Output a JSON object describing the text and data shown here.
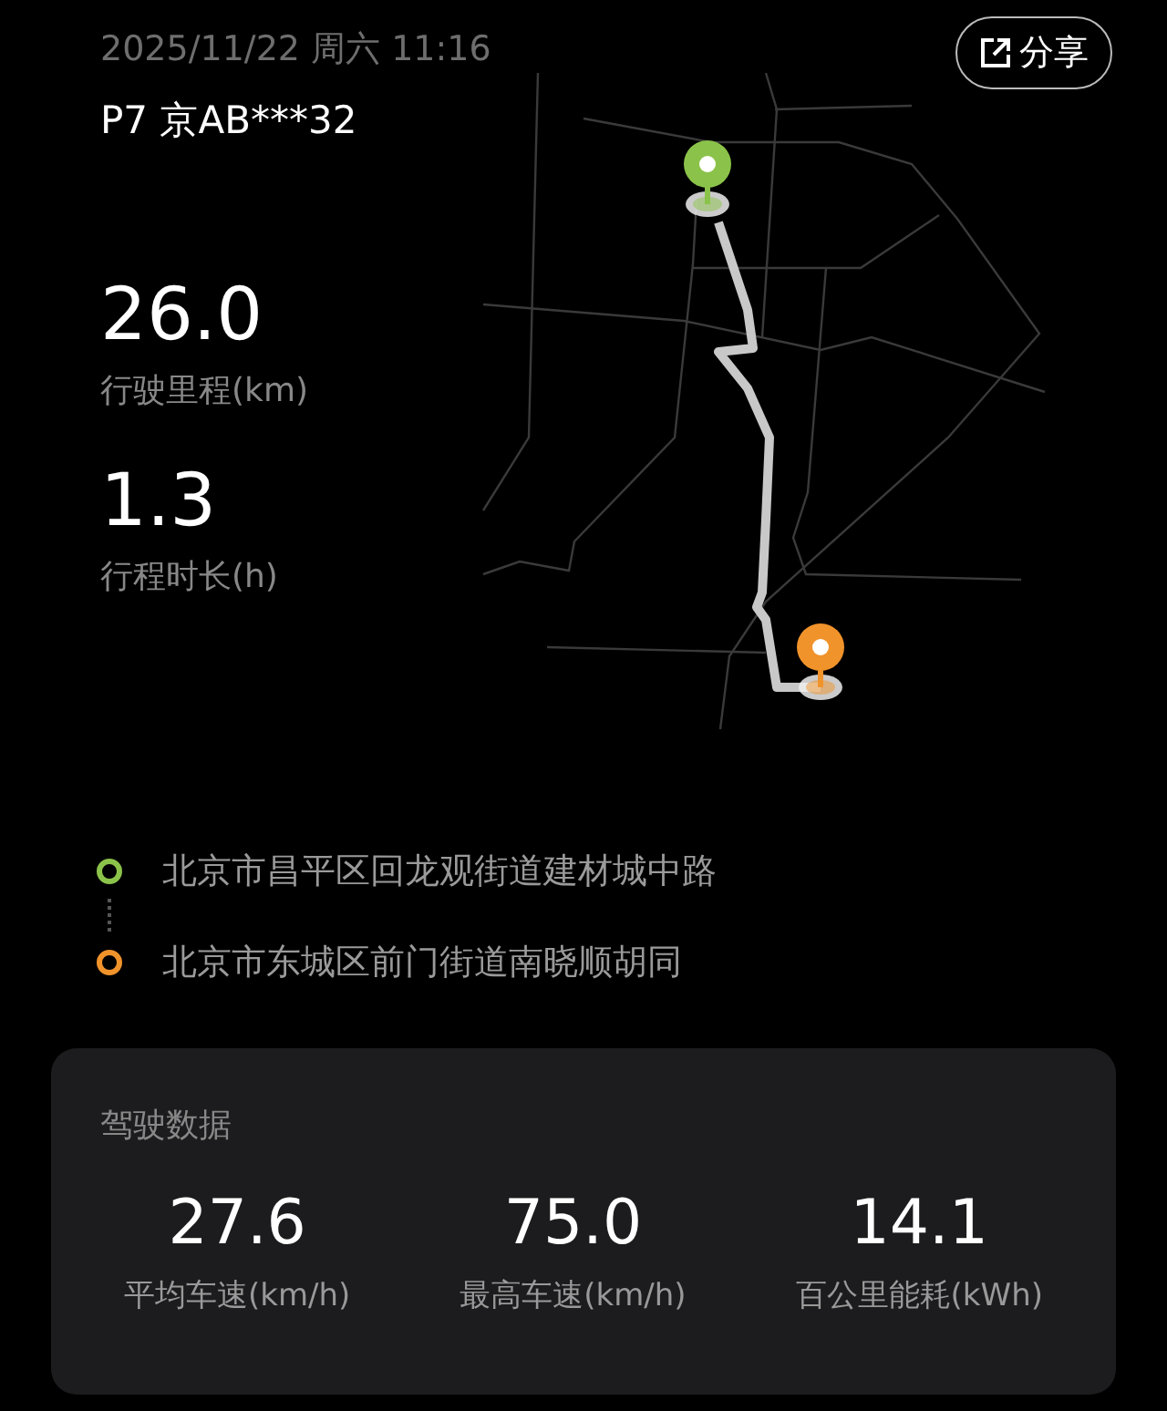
{
  "header": {
    "datetime": "2025/11/22 周六 11:16",
    "vehicle": "P7 京AB***32",
    "share": {
      "label": "分享"
    }
  },
  "stats": [
    {
      "value": "26.0",
      "label": "行驶里程(km)"
    },
    {
      "value": "1.3",
      "label": "行程时长(h)"
    }
  ],
  "addresses": [
    {
      "text": "北京市昌平区回龙观街道建材城中路",
      "color": "#8bc34a"
    },
    {
      "text": "北京市东城区前门街道南晓顺胡同",
      "color": "#f0932b"
    }
  ],
  "driving_data": {
    "title": "驾驶数据",
    "items": [
      {
        "value": "27.6",
        "label": "平均车速(km/h)"
      },
      {
        "value": "75.0",
        "label": "最高车速(km/h)"
      },
      {
        "value": "14.1",
        "label": "百公里能耗(kWh)"
      }
    ]
  }
}
